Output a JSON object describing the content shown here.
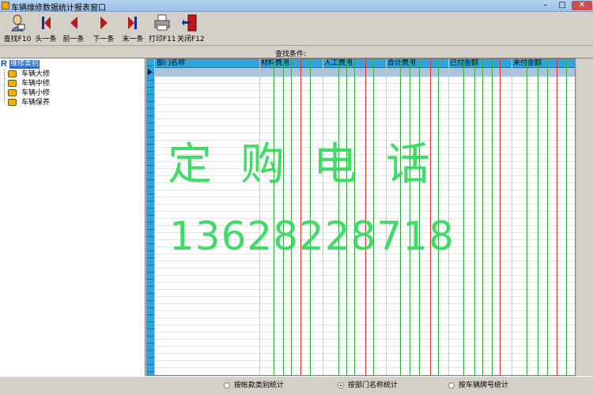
{
  "window": {
    "title": "车辆维修数据统计报表窗口",
    "minimize": "–",
    "maximize": "□",
    "close": "✕"
  },
  "toolbar": {
    "query": "查找F10",
    "first": "头一条",
    "prev": "前一条",
    "next": "下一条",
    "last": "末一条",
    "print": "打印F11",
    "close": "关闭F12"
  },
  "condition": {
    "label": "查找条件:"
  },
  "tree": {
    "root": "维修类别",
    "items": [
      "车辆大修",
      "车辆中修",
      "车辆小修",
      "车辆保养"
    ]
  },
  "grid": {
    "columns": [
      "部门名称",
      "材料费用",
      "人工费用",
      "合计费用",
      "已付金额",
      "未付金额"
    ]
  },
  "watermark": {
    "line1": "定购电话",
    "line2": "13628228718"
  },
  "footer": {
    "options": [
      {
        "label": "按帐款类别统计",
        "selected": false
      },
      {
        "label": "按部门名称统计",
        "selected": true
      },
      {
        "label": "按车辆牌号统计",
        "selected": false
      }
    ]
  },
  "colors": {
    "header": "#2ea4df",
    "selected_row": "#a9c4dc",
    "green_line": "#2fae3c",
    "red_line": "#e0302a",
    "watermark": "#2ed85a"
  }
}
